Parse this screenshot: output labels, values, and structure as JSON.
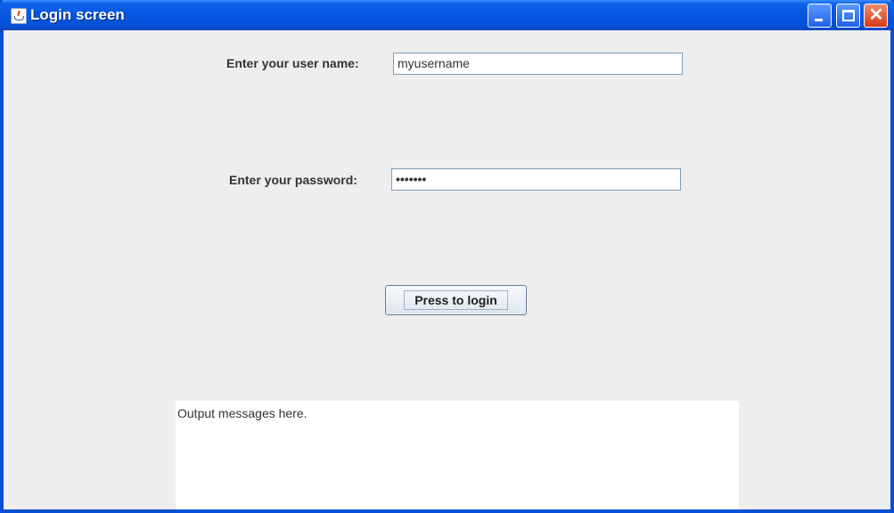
{
  "window": {
    "title": "Login screen",
    "icon": "java-cup-icon",
    "controls": {
      "minimize": "minimize-icon",
      "maximize": "maximize-icon",
      "close": "close-icon",
      "close_glyph": "✕"
    }
  },
  "form": {
    "username_label": "Enter your user name:",
    "username_value": "myusername",
    "password_label": "Enter your password:",
    "password_value": "•••••••",
    "login_button": "Press to login"
  },
  "output": {
    "text": "Output messages here."
  },
  "colors": {
    "titlebar": "#0656e0",
    "border": "#0a4fd6",
    "background": "#eeeeee",
    "field_border": "#7f9db9"
  }
}
